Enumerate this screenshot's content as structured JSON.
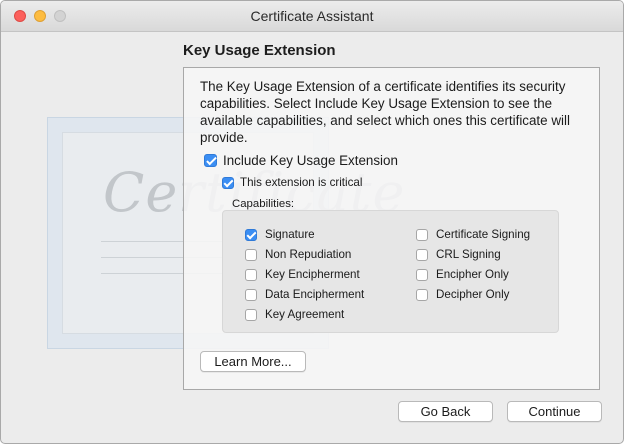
{
  "window": {
    "title": "Certificate Assistant"
  },
  "page": {
    "heading": "Key Usage Extension",
    "description": "The Key Usage Extension of a certificate identifies its security capabilities. Select Include Key Usage Extension to see the available capabilities, and select which ones this certificate will provide."
  },
  "options": {
    "include": {
      "label": "Include Key Usage Extension",
      "checked": true
    },
    "critical": {
      "label": "This extension is critical",
      "checked": true
    }
  },
  "capabilities": {
    "title": "Capabilities:",
    "left": [
      {
        "label": "Signature",
        "checked": true
      },
      {
        "label": "Non Repudiation",
        "checked": false
      },
      {
        "label": "Key Encipherment",
        "checked": false
      },
      {
        "label": "Data Encipherment",
        "checked": false
      },
      {
        "label": "Key Agreement",
        "checked": false
      }
    ],
    "right": [
      {
        "label": "Certificate Signing",
        "checked": false
      },
      {
        "label": "CRL Signing",
        "checked": false
      },
      {
        "label": "Encipher Only",
        "checked": false
      },
      {
        "label": "Decipher Only",
        "checked": false
      }
    ]
  },
  "buttons": {
    "learn_more": "Learn More...",
    "go_back": "Go Back",
    "continue": "Continue"
  },
  "watermark": {
    "text": "Certificate"
  }
}
